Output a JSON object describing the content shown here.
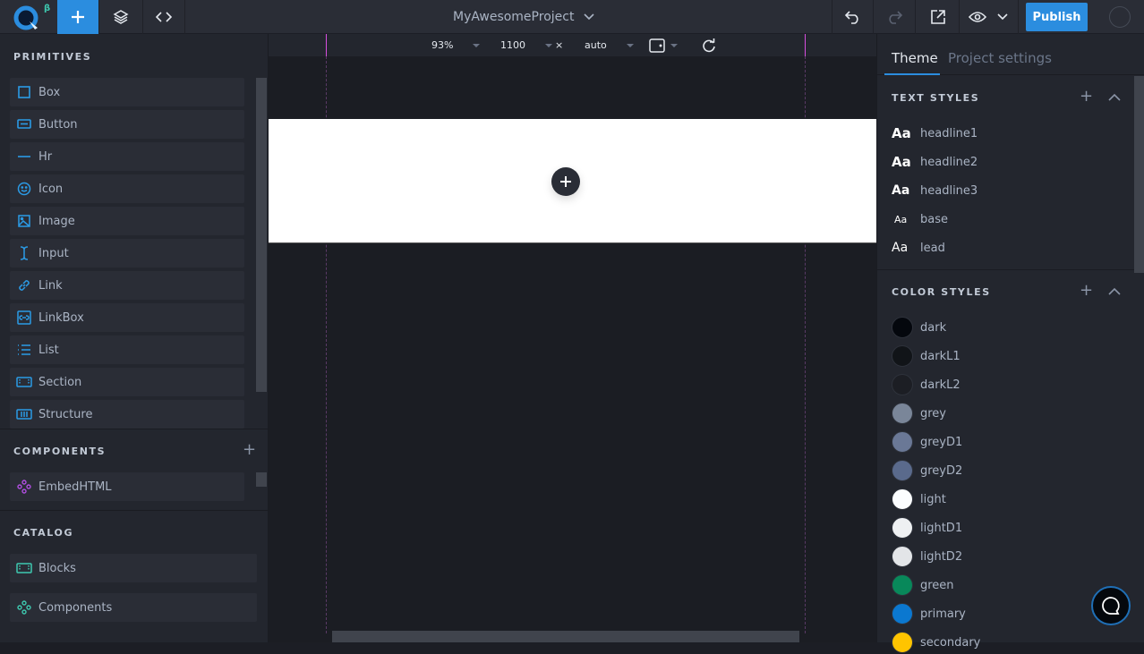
{
  "topbar": {
    "logo_badge": "β",
    "project_title": "MyAwesomeProject",
    "publish_label": "Publish"
  },
  "canvas_bar": {
    "zoom": "93%",
    "width": "1100",
    "times": "×",
    "height": "auto"
  },
  "left": {
    "primitives_title": "PRIMITIVES",
    "primitives": [
      {
        "label": "Box",
        "icon": "square-icon"
      },
      {
        "label": "Button",
        "icon": "button-icon"
      },
      {
        "label": "Hr",
        "icon": "hr-icon"
      },
      {
        "label": "Icon",
        "icon": "smiley-icon"
      },
      {
        "label": "Image",
        "icon": "image-icon"
      },
      {
        "label": "Input",
        "icon": "text-cursor-icon"
      },
      {
        "label": "Link",
        "icon": "link-icon"
      },
      {
        "label": "LinkBox",
        "icon": "linkbox-icon"
      },
      {
        "label": "List",
        "icon": "list-icon"
      },
      {
        "label": "Section",
        "icon": "section-icon"
      },
      {
        "label": "Structure",
        "icon": "structure-icon"
      }
    ],
    "components_title": "COMPONENTS",
    "components": [
      {
        "label": "EmbedHTML",
        "icon": "component-icon",
        "color": "#b04ee0"
      }
    ],
    "catalog_title": "CATALOG",
    "catalog": [
      {
        "label": "Blocks",
        "icon": "blocks-icon",
        "color": "#3ec9b0"
      },
      {
        "label": "Components",
        "icon": "component-icon",
        "color": "#3ec9b0"
      }
    ]
  },
  "right": {
    "tabs": [
      {
        "label": "Theme",
        "active": true
      },
      {
        "label": "Project settings",
        "active": false
      }
    ],
    "text_styles_title": "TEXT STYLES",
    "text_styles": [
      {
        "label": "headline1",
        "sample": "Aa"
      },
      {
        "label": "headline2",
        "sample": "Aa"
      },
      {
        "label": "headline3",
        "sample": "Aa"
      },
      {
        "label": "base",
        "sample": "Aa"
      },
      {
        "label": "lead",
        "sample": "Aa"
      }
    ],
    "color_styles_title": "COLOR STYLES",
    "color_styles": [
      {
        "label": "dark",
        "color": "#04070d"
      },
      {
        "label": "darkL1",
        "color": "#111418"
      },
      {
        "label": "darkL2",
        "color": "#1c1e24"
      },
      {
        "label": "grey",
        "color": "#7a8699"
      },
      {
        "label": "greyD1",
        "color": "#6a7896"
      },
      {
        "label": "greyD2",
        "color": "#5a6a8c"
      },
      {
        "label": "light",
        "color": "#fbfdff"
      },
      {
        "label": "lightD1",
        "color": "#eef0f2"
      },
      {
        "label": "lightD2",
        "color": "#e3e5e8"
      },
      {
        "label": "green",
        "color": "#08885a"
      },
      {
        "label": "primary",
        "color": "#0b78d0"
      },
      {
        "label": "secondary",
        "color": "#ffc400"
      }
    ]
  },
  "colors": {
    "accent": "#2b8ddf",
    "guide": "#d84fe0"
  }
}
